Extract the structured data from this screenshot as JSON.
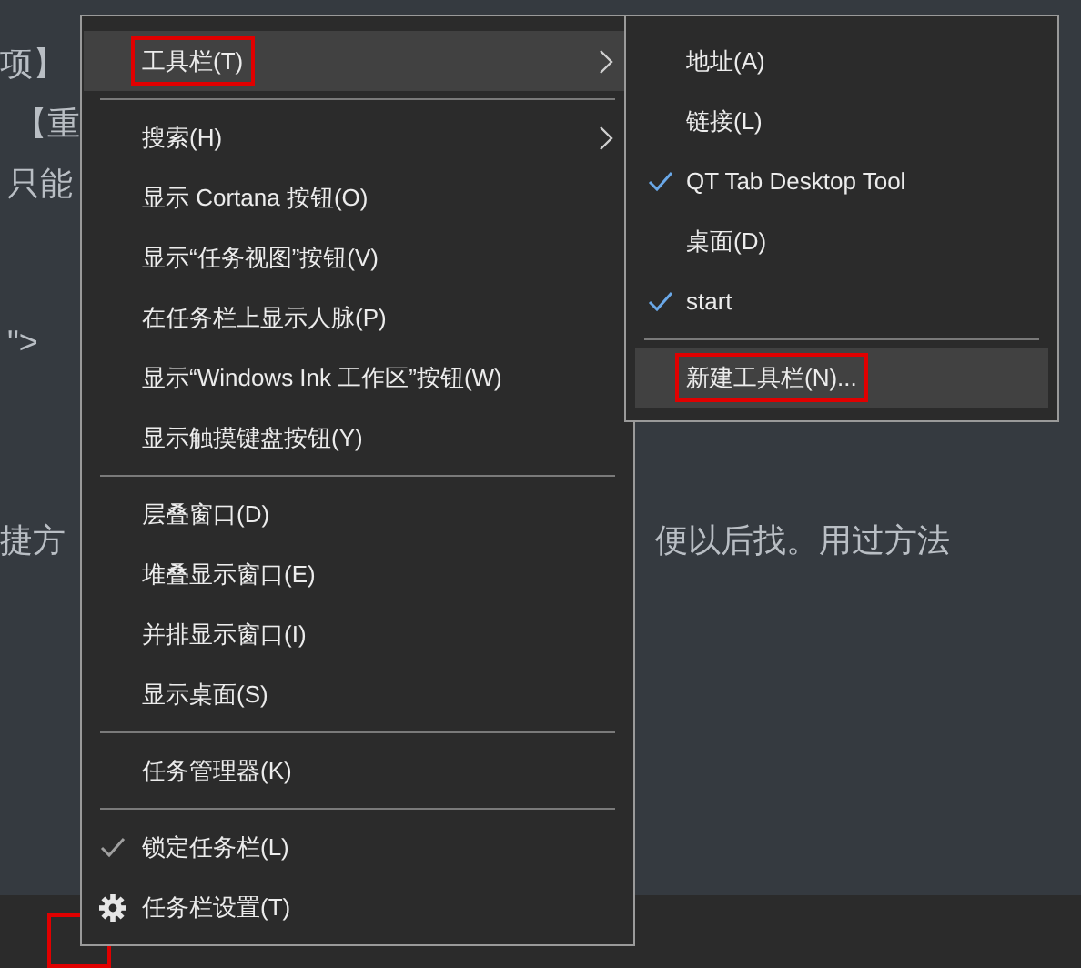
{
  "background_text": [
    {
      "text": "项】",
      "kind": "left"
    },
    {
      "text": "【重",
      "kind": "left"
    },
    {
      "text": "只能",
      "kind": "left"
    },
    {
      "text": "\">",
      "kind": "left"
    },
    {
      "text": "捷方",
      "kind": "left"
    },
    {
      "text": "便以后找。用过方法",
      "kind": "right"
    }
  ],
  "context_menu": {
    "items": [
      {
        "kind": "item",
        "label": "工具栏(T)",
        "selected": true,
        "submenu": true,
        "outlined": true
      },
      {
        "kind": "separator"
      },
      {
        "kind": "item",
        "label": "搜索(H)",
        "selected": false,
        "submenu": true
      },
      {
        "kind": "item",
        "label": "显示 Cortana 按钮(O)",
        "selected": false
      },
      {
        "kind": "item",
        "label": "显示“任务视图”按钮(V)",
        "selected": false
      },
      {
        "kind": "item",
        "label": "在任务栏上显示人脉(P)",
        "selected": false
      },
      {
        "kind": "item",
        "label": "显示“Windows Ink 工作区”按钮(W)",
        "selected": false
      },
      {
        "kind": "item",
        "label": "显示触摸键盘按钮(Y)",
        "selected": false
      },
      {
        "kind": "separator"
      },
      {
        "kind": "item",
        "label": "层叠窗口(D)",
        "selected": false
      },
      {
        "kind": "item",
        "label": "堆叠显示窗口(E)",
        "selected": false
      },
      {
        "kind": "item",
        "label": "并排显示窗口(I)",
        "selected": false
      },
      {
        "kind": "item",
        "label": "显示桌面(S)",
        "selected": false
      },
      {
        "kind": "separator"
      },
      {
        "kind": "item",
        "label": "任务管理器(K)",
        "selected": false
      },
      {
        "kind": "separator"
      },
      {
        "kind": "check",
        "label": "锁定任务栏(L)",
        "selected": false,
        "checked": true
      },
      {
        "kind": "settings",
        "label": "任务栏设置(T)",
        "selected": false
      }
    ]
  },
  "toolbar_submenu": {
    "items": [
      {
        "kind": "check",
        "label": "地址(A)",
        "selected": false,
        "checked": false
      },
      {
        "kind": "check",
        "label": "链接(L)",
        "selected": false,
        "checked": false
      },
      {
        "kind": "check",
        "label": "QT Tab Desktop Tool",
        "selected": false,
        "checked": true
      },
      {
        "kind": "check",
        "label": "桌面(D)",
        "selected": false,
        "checked": false
      },
      {
        "kind": "check",
        "label": "start",
        "selected": false,
        "checked": true
      },
      {
        "kind": "separator"
      },
      {
        "kind": "item",
        "label": "新建工具栏(N)...",
        "selected": true,
        "outlined": true
      }
    ]
  },
  "taskbar": {
    "highlight_marker": true
  }
}
